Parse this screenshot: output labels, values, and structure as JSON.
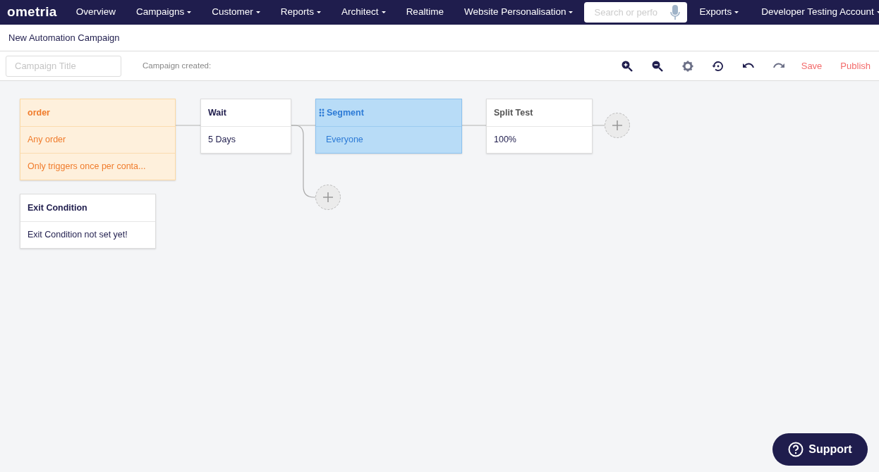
{
  "navbar": {
    "logo": "ometria",
    "items": [
      {
        "label": "Overview",
        "dropdown": false
      },
      {
        "label": "Campaigns",
        "dropdown": true
      },
      {
        "label": "Customer",
        "dropdown": true
      },
      {
        "label": "Reports",
        "dropdown": true
      },
      {
        "label": "Architect",
        "dropdown": true
      },
      {
        "label": "Realtime",
        "dropdown": false
      },
      {
        "label": "Website Personalisation",
        "dropdown": true
      }
    ],
    "search": {
      "placeholder": "Search or perfo"
    },
    "right_items": [
      {
        "label": "Exports",
        "dropdown": true
      },
      {
        "label": "Developer Testing Account",
        "dropdown": true
      }
    ]
  },
  "page_title": "New Automation Campaign",
  "toolbar": {
    "title_field": {
      "placeholder": "Campaign Title"
    },
    "created_label": "Campaign created:",
    "actions": [
      {
        "label": "Save"
      },
      {
        "label": "Publish"
      }
    ]
  },
  "canvas": {
    "nodes": [
      {
        "kind": "trigger",
        "title": "order",
        "rows": [
          "Any order",
          "Only triggers once per conta..."
        ],
        "selected": false
      },
      {
        "kind": "step",
        "title": "Wait",
        "rows": [
          "5 Days"
        ],
        "selected": false
      },
      {
        "kind": "step",
        "title": "Segment",
        "rows": [
          "Everyone"
        ],
        "selected": true
      },
      {
        "kind": "step",
        "title": "Split Test",
        "rows": [
          "100%"
        ],
        "selected": false
      },
      {
        "kind": "exit",
        "title": "Exit Condition",
        "rows": [
          "Exit Condition not set yet!"
        ],
        "selected": false
      }
    ]
  },
  "support_button": {
    "label": "Support"
  }
}
